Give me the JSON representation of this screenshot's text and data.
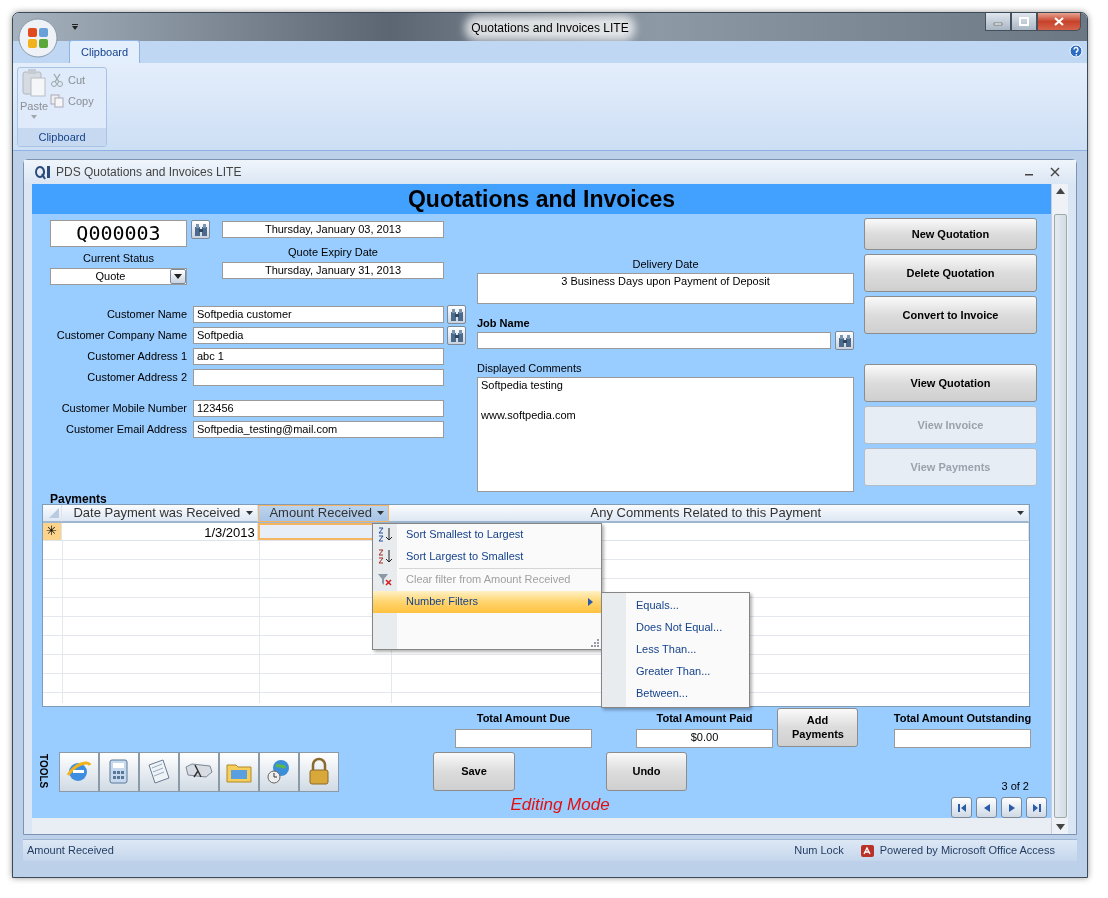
{
  "window": {
    "title": "Quotations and Invoices LITE"
  },
  "ribbon": {
    "tabs": [
      {
        "label": "Clipboard",
        "selected": true
      }
    ],
    "groups": [
      {
        "label": "Clipboard",
        "commands": [
          {
            "label": "Paste",
            "kind": "large",
            "disabled": true
          },
          {
            "label": "Cut",
            "kind": "small",
            "disabled": true
          },
          {
            "label": "Copy",
            "kind": "small",
            "disabled": true
          }
        ]
      }
    ]
  },
  "form_window": {
    "title": "PDS Quotations and Invoices LITE"
  },
  "form": {
    "heading": "Quotations and Invoices",
    "quote_number": "Q000003",
    "quote_date": "Thursday, January 03, 2013",
    "current_status": {
      "label": "Current Status",
      "value": "Quote"
    },
    "quote_expiry": {
      "label": "Quote Expiry Date",
      "value": "Thursday, January 31, 2013"
    },
    "customer_field_groups": [
      [
        {
          "label": "Customer Name",
          "value": "Softpedia customer",
          "lookup": true
        },
        {
          "label": "Customer Company Name",
          "value": "Softpedia",
          "lookup": true
        },
        {
          "label": "Customer Address 1",
          "value": "abc 1",
          "lookup": false
        },
        {
          "label": "Customer Address 2",
          "lookup": false
        }
      ],
      [
        {
          "label": "Customer Mobile Number",
          "value": "123456",
          "lookup": false
        },
        {
          "label": "Customer Email Address",
          "value": "Softpedia_testing@mail.com",
          "lookup": false
        }
      ]
    ],
    "delivery_date": {
      "label": "Delivery Date",
      "value": "3 Business Days upon Payment of Deposit"
    },
    "job_name": {
      "label": "Job Name"
    },
    "comments": {
      "label": "Displayed Comments",
      "value": "Softpedia testing\n\nwww.softpedia.com"
    },
    "action_groups": [
      [
        {
          "label": "New Quotation",
          "disabled": false
        },
        {
          "label": "Delete Quotation",
          "disabled": false
        },
        {
          "label": "Convert to Invoice",
          "disabled": false
        }
      ],
      [
        {
          "label": "View Quotation",
          "disabled": false
        },
        {
          "label": "View Invoice",
          "disabled": true
        },
        {
          "label": "View Payments",
          "disabled": true
        }
      ]
    ],
    "payments": {
      "label": "Payments",
      "columns": [
        {
          "label": "Date Payment was Received",
          "selected": false
        },
        {
          "label": "Amount Received",
          "selected": true
        },
        {
          "label": "Any Comments Related to this Payment",
          "selected": false
        }
      ],
      "rows": [
        {
          "marker": "✳",
          "cells": [
            {
              "value": "1/3/2013",
              "focused": false
            },
            {
              "focused": true
            },
            {
              "focused": false
            }
          ]
        }
      ],
      "column_menu": {
        "sections": [
          [
            {
              "label": "Sort Smallest to Largest",
              "kind": "sort-asc",
              "disabled": false,
              "selected": false
            },
            {
              "label": "Sort Largest to Smallest",
              "kind": "sort-desc",
              "disabled": false,
              "selected": false
            }
          ],
          [
            {
              "label": "Clear filter from Amount Received",
              "kind": "clear-filter",
              "disabled": true,
              "selected": false
            },
            {
              "label": "Number Filters",
              "kind": "submenu",
              "disabled": false,
              "selected": true
            }
          ]
        ],
        "submenu": [
          {
            "label": "Equals..."
          },
          {
            "label": "Does Not Equal..."
          },
          {
            "label": "Less Than..."
          },
          {
            "label": "Greater Than..."
          },
          {
            "label": "Between..."
          }
        ]
      }
    },
    "totals": [
      {
        "label": "Total Amount Due"
      },
      {
        "label": "Total Amount Paid",
        "value": "$0.00"
      },
      {
        "label": "Total Amount Outstanding"
      }
    ],
    "add_payments": {
      "label": "Add Payments"
    },
    "tools": {
      "label": "TOOLS"
    },
    "save": {
      "label": "Save"
    },
    "undo": {
      "label": "Undo"
    },
    "mode": "Editing Mode",
    "record_counter": "3 of 2"
  },
  "status_bar": {
    "left": "Amount Received",
    "indicators": [
      "Num Lock"
    ],
    "powered_by": "Powered by Microsoft Office Access"
  }
}
